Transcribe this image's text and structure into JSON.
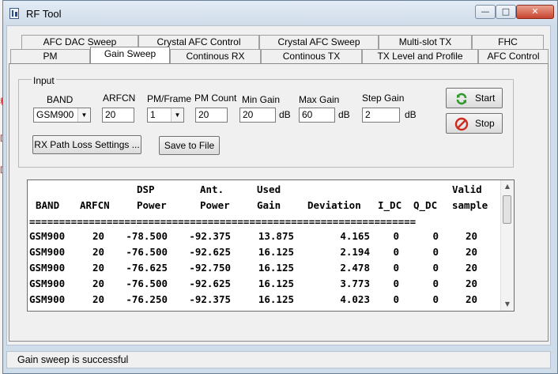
{
  "window": {
    "title": "RF Tool",
    "min_glyph": "—",
    "max_glyph": "□",
    "close_glyph": "✕"
  },
  "tabs_top": [
    "AFC DAC Sweep",
    "Crystal AFC Control",
    "Crystal AFC Sweep",
    "Multi-slot TX",
    "FHC"
  ],
  "tabs_bottom": [
    "PM",
    "Gain Sweep",
    "Continous RX",
    "Continous TX",
    "TX Level and Profile",
    "AFC Control"
  ],
  "active_tab": "Gain Sweep",
  "input": {
    "group_label": "Input",
    "band": {
      "label": "BAND",
      "value": "GSM900"
    },
    "arfcn": {
      "label": "ARFCN",
      "value": "20"
    },
    "pm_frame": {
      "label": "PM/Frame",
      "value": "1"
    },
    "pm_count": {
      "label": "PM Count",
      "value": "20"
    },
    "min_gain": {
      "label": "Min Gain",
      "value": "20",
      "unit": "dB"
    },
    "max_gain": {
      "label": "Max Gain",
      "value": "60",
      "unit": "dB"
    },
    "step_gain": {
      "label": "Step Gain",
      "value": "2",
      "unit": "dB"
    },
    "rx_path_button": "RX Path Loss Settings ...",
    "save_button": "Save to File",
    "start_button": "Start",
    "stop_button": "Stop"
  },
  "results": {
    "header_line1": [
      "",
      "",
      "DSP",
      "Ant.",
      "Used",
      "",
      "",
      "",
      "Valid"
    ],
    "header_line2": [
      "BAND",
      "ARFCN",
      "Power",
      "Power",
      "Gain",
      "Deviation",
      "I_DC",
      "Q_DC",
      "sample"
    ],
    "separator": "=================================================================",
    "rows": [
      [
        "GSM900",
        "20",
        "-78.500",
        "-92.375",
        "13.875",
        "4.165",
        "0",
        "0",
        "20"
      ],
      [
        "GSM900",
        "20",
        "-76.500",
        "-92.625",
        "16.125",
        "2.194",
        "0",
        "0",
        "20"
      ],
      [
        "GSM900",
        "20",
        "-76.625",
        "-92.750",
        "16.125",
        "2.478",
        "0",
        "0",
        "20"
      ],
      [
        "GSM900",
        "20",
        "-76.500",
        "-92.625",
        "16.125",
        "3.773",
        "0",
        "0",
        "20"
      ],
      [
        "GSM900",
        "20",
        "-76.250",
        "-92.375",
        "16.125",
        "4.023",
        "0",
        "0",
        "20"
      ]
    ]
  },
  "status": "Gain sweep is successful",
  "icons": {
    "start": "refresh-icon",
    "stop": "stop-icon"
  },
  "colors": {
    "start_icon": "#2e9a2e",
    "stop_icon": "#cc2a1e"
  }
}
